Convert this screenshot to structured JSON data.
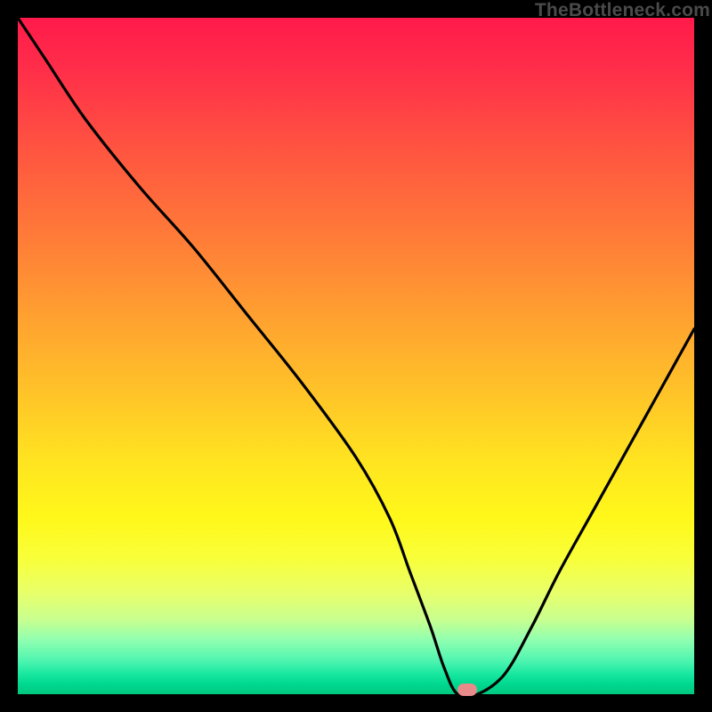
{
  "watermark": "TheBottleneck.com",
  "chart_data": {
    "type": "line",
    "title": "",
    "xlabel": "",
    "ylabel": "",
    "xlim": [
      0,
      100
    ],
    "ylim": [
      0,
      100
    ],
    "x": [
      0,
      4,
      10,
      18,
      26,
      34,
      42,
      50,
      55,
      58,
      61,
      63,
      65,
      68,
      72,
      76,
      80,
      85,
      90,
      95,
      100
    ],
    "values": [
      100,
      94,
      85,
      75,
      66,
      56,
      46,
      35,
      26,
      18,
      10,
      4,
      0,
      0,
      3,
      10,
      18,
      27,
      36,
      45,
      54
    ],
    "marker": {
      "x": 66.5,
      "y": 0.6
    },
    "gradient_stops": [
      {
        "pos": 0,
        "color": "#ff1a4b"
      },
      {
        "pos": 0.66,
        "color": "#fff81a"
      },
      {
        "pos": 0.97,
        "color": "#18e8a0"
      },
      {
        "pos": 1.0,
        "color": "#00c880"
      }
    ]
  }
}
